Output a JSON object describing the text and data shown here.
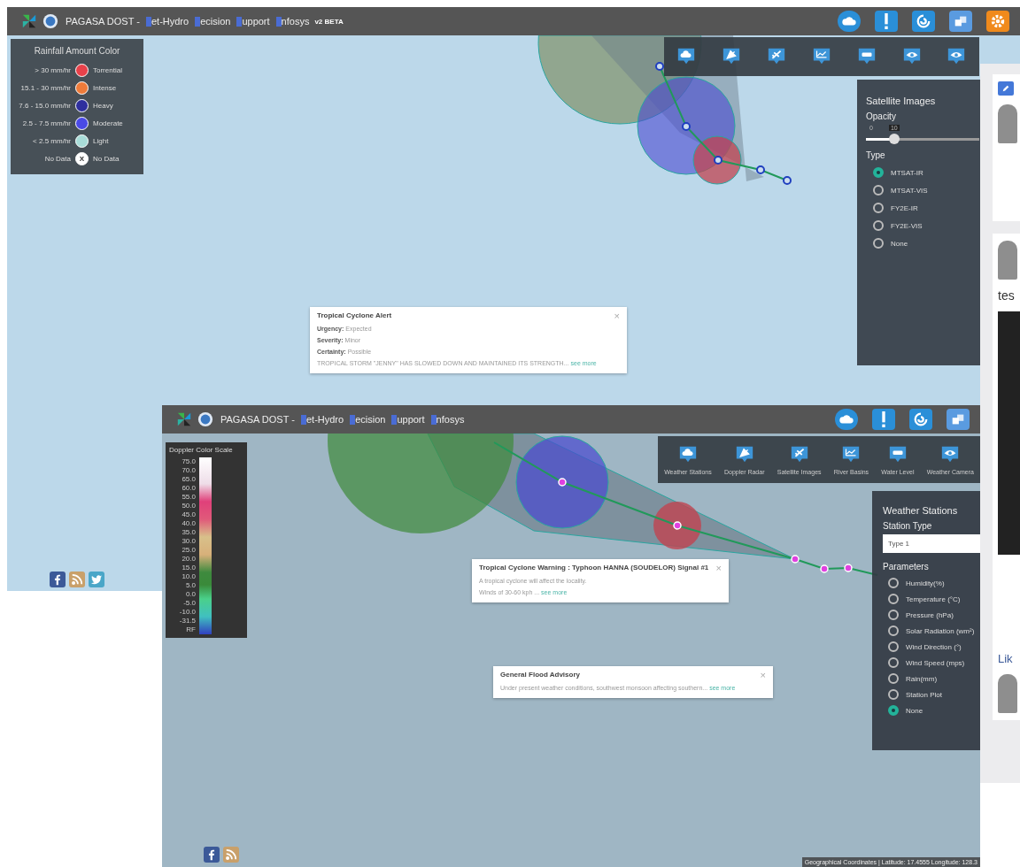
{
  "window_1": {
    "header": {
      "title": "PAGASA DOST -",
      "title_words": [
        "et-Hydro",
        "ecision",
        "upport",
        "nfosys"
      ],
      "badge": "v2 BETA",
      "icons": [
        {
          "kind": "cloud"
        },
        {
          "kind": "alert"
        },
        {
          "kind": "swirl"
        },
        {
          "kind": "windows"
        },
        {
          "kind": "gear"
        }
      ]
    },
    "toolbar": [
      {
        "kind": "stations"
      },
      {
        "kind": "radar"
      },
      {
        "kind": "satellite"
      },
      {
        "kind": "basins"
      },
      {
        "kind": "water"
      },
      {
        "kind": "camera"
      },
      {
        "kind": "camera"
      }
    ],
    "rainfall_legend": {
      "title": "Rainfall Amount Color",
      "rows": [
        {
          "range": "> 30 mm/hr",
          "label": "Torrential",
          "color": "#e8414a"
        },
        {
          "range": "15.1 - 30 mm/hr",
          "label": "Intense",
          "color": "#ee7b3a"
        },
        {
          "range": "7.6 - 15.0 mm/hr",
          "label": "Heavy",
          "color": "#2e2f9e"
        },
        {
          "range": "2.5 - 7.5 mm/hr",
          "label": "Moderate",
          "color": "#4a4ae6"
        },
        {
          "range": "< 2.5 mm/hr",
          "label": "Light",
          "color": "#a8dcd8"
        },
        {
          "range": "No Data",
          "label": "No Data",
          "color": "#ffffff",
          "symbol": "X"
        }
      ]
    },
    "satellite_panel": {
      "title": "Satellite Images",
      "opacity_label": "Opacity",
      "slider_min": "0",
      "slider_value": "10",
      "level": 0.25,
      "type_label": "Type",
      "options": [
        {
          "label": "MTSAT-IR",
          "selected": true
        },
        {
          "label": "MTSAT-VIS",
          "selected": false
        },
        {
          "label": "FY2E-IR",
          "selected": false
        },
        {
          "label": "FY2E-VIS",
          "selected": false
        },
        {
          "label": "None",
          "selected": false
        }
      ]
    },
    "alert_popup": {
      "title": "Tropical Cyclone Alert",
      "fields": [
        {
          "label": "Urgency:",
          "value": "Expected"
        },
        {
          "label": "Severity:",
          "value": "Minor"
        },
        {
          "label": "Certainty:",
          "value": "Possible"
        }
      ],
      "text": "TROPICAL STORM \"JENNY\" HAS SLOWED DOWN AND MAINTAINED ITS STRENGTH...",
      "link": "see more",
      "close": "×"
    },
    "social": [
      {
        "kind": "facebook"
      },
      {
        "kind": "rss"
      },
      {
        "kind": "twitter"
      }
    ],
    "side_feed": {
      "post_text": "tes",
      "like_text": "Lik"
    }
  },
  "window_2": {
    "header": {
      "title": "PAGASA DOST -",
      "title_words": [
        "et-Hydro",
        "ecision",
        "upport",
        "nfosys"
      ],
      "icons": [
        {
          "kind": "cloud"
        },
        {
          "kind": "alert"
        },
        {
          "kind": "swirl"
        },
        {
          "kind": "windows"
        }
      ]
    },
    "toolbar": [
      {
        "kind": "stations",
        "label": "Weather Stations"
      },
      {
        "kind": "radar",
        "label": "Doppler Radar"
      },
      {
        "kind": "satellite",
        "label": "Satellite Images"
      },
      {
        "kind": "basins",
        "label": "River Basins"
      },
      {
        "kind": "water",
        "label": "Water Level"
      },
      {
        "kind": "camera",
        "label": "Weather Camera"
      }
    ],
    "doppler_scale": {
      "title": "Doppler Color Scale",
      "ticks": [
        "75.0",
        "70.0",
        "65.0",
        "60.0",
        "55.0",
        "50.0",
        "45.0",
        "40.0",
        "35.0",
        "30.0",
        "25.0",
        "20.0",
        "15.0",
        "10.0",
        "5.0",
        "0.0",
        "-5.0",
        "-10.0",
        "-31.5",
        "RF"
      ]
    },
    "stations_panel": {
      "title": "Weather Stations",
      "station_type_label": "Station Type",
      "station_type_value": "Type 1",
      "parameters_label": "Parameters",
      "options": [
        {
          "label": "Humidity(%)",
          "selected": false
        },
        {
          "label": "Temperature (°C)",
          "selected": false
        },
        {
          "label": "Pressure (hPa)",
          "selected": false
        },
        {
          "label": "Solar Radiation (wm²)",
          "selected": false
        },
        {
          "label": "Wind Direction (°)",
          "selected": false
        },
        {
          "label": "Wind Speed (mps)",
          "selected": false
        },
        {
          "label": "Rain(mm)",
          "selected": false
        },
        {
          "label": "Station Plot",
          "selected": false
        },
        {
          "label": "None",
          "selected": true
        }
      ]
    },
    "warning_popup": {
      "title": "Tropical Cyclone Warning : Typhoon HANNA (SOUDELOR) Signal #1",
      "lines": [
        "A tropical cyclone will affect the locality."
      ],
      "last_line": "Winds of 30-60 kph ...",
      "link": "see more",
      "close": "×"
    },
    "flood_popup": {
      "title": "General Flood Advisory",
      "text": "Under present weather conditions, southwest monsoon affecting southern...",
      "link": "see more",
      "close": "×"
    },
    "social": [
      {
        "kind": "facebook"
      },
      {
        "kind": "rss"
      }
    ],
    "status": "Geographical Coordinates | Latitude: 17.4555 Longitude: 128.3"
  }
}
